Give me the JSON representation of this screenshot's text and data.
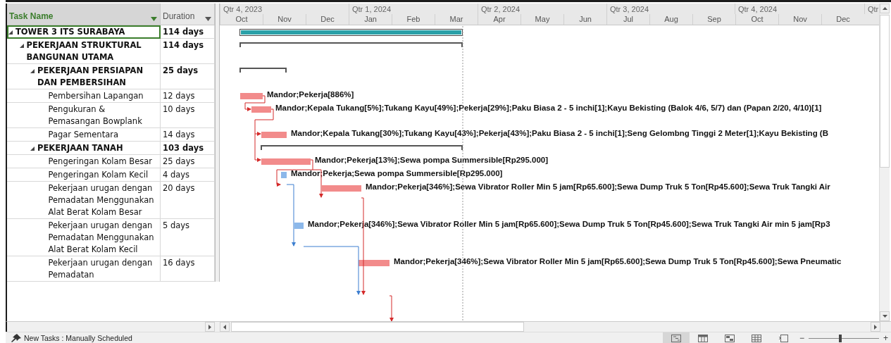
{
  "header": {
    "task_name": "Task Name",
    "duration": "Duration"
  },
  "timescale": {
    "quarters": [
      "Qtr 4, 2023",
      "Qtr 1, 2024",
      "Qtr 2, 2024",
      "Qtr 3, 2024",
      "Qtr 4, 2024",
      "Qtr"
    ],
    "months": [
      "Oct",
      "Nov",
      "Dec",
      "Jan",
      "Feb",
      "Mar",
      "Apr",
      "May",
      "Jun",
      "Jul",
      "Aug",
      "Sep",
      "Oct",
      "Nov",
      "Dec"
    ]
  },
  "tasks": [
    {
      "name": "TOWER 3 ITS SURABAYA",
      "duration": "114 days",
      "selected": true,
      "expanded": true,
      "kind": "project",
      "children": [
        {
          "name": "PEKERJAAN STRUKTURAL BANGUNAN UTAMA",
          "duration": "114 days",
          "selected": false,
          "expanded": true,
          "kind": "summary",
          "children": [
            {
              "name": "PEKERJAAN PERSIAPAN DAN PEMBERSIHAN",
              "duration": "25 days",
              "selected": false,
              "expanded": true,
              "kind": "summary",
              "children": [
                {
                  "name": "Pembersihan Lapangan",
                  "duration": "12 days",
                  "selected": false,
                  "kind": "task",
                  "critical": true,
                  "resources": "Mandor;Pekerja[886%]"
                },
                {
                  "name": "Pengukuran & Pemasangan Bowplank",
                  "duration": "10 days",
                  "selected": false,
                  "kind": "task",
                  "critical": true,
                  "resources": "Mandor;Kepala Tukang[5%];Tukang Kayu[49%];Pekerja[29%];Paku Biasa  2 - 5 inchi[1];Kayu Bekisting (Balok 4/6, 5/7) dan (Papan 2/20, 4/10)[1]"
                },
                {
                  "name": "Pagar Sementara",
                  "duration": "14 days",
                  "selected": false,
                  "kind": "task",
                  "critical": true,
                  "resources": "Mandor;Kepala Tukang[30%];Tukang Kayu[43%];Pekerja[43%];Paku Biasa  2 - 5 inchi[1];Seng Gelombng Tinggi 2 Meter[1];Kayu Bekisting (B"
                }
              ]
            },
            {
              "name": "PEKERJAAN TANAH",
              "duration": "103 days",
              "selected": false,
              "expanded": true,
              "kind": "summary",
              "children": [
                {
                  "name": "Pengeringan Kolam Besar",
                  "duration": "25 days",
                  "selected": false,
                  "kind": "task",
                  "critical": true,
                  "resources": "Mandor;Pekerja[13%];Sewa pompa Summersible[Rp295.000]"
                },
                {
                  "name": "Pengeringan Kolam Kecil",
                  "duration": "4 days",
                  "selected": false,
                  "kind": "task",
                  "critical": false,
                  "resources": "Mandor;Pekerja;Sewa pompa Summersible[Rp295.000]"
                },
                {
                  "name": "Pekerjaan urugan dengan Pemadatan Menggunakan Alat Berat Kolam Besar",
                  "duration": "20 days",
                  "selected": false,
                  "kind": "task",
                  "critical": true,
                  "resources": "Mandor;Pekerja[346%];Sewa Vibrator Roller Min 5 jam[Rp65.600];Sewa Dump Truk 5 Ton[Rp45.600];Sewa Truk Tangki Air"
                },
                {
                  "name": "Pekerjaan urugan dengan Pemadatan Menggunakan Alat Berat Kolam Kecil",
                  "duration": "5 days",
                  "selected": false,
                  "kind": "task",
                  "critical": false,
                  "resources": "Mandor;Pekerja[346%];Sewa Vibrator Roller Min 5 jam[Rp65.600];Sewa Dump Truk 5 Ton[Rp45.600];Sewa Truk Tangki Air min 5 jam[Rp3"
                },
                {
                  "name": "Pekerjaan urugan dengan Pemadatan",
                  "duration": "16 days",
                  "selected": false,
                  "kind": "task",
                  "critical": true,
                  "resources": "Mandor;Pekerja[346%];Sewa Vibrator Roller Min 5 jam[Rp65.600];Sewa Dump Truk 5 Ton[Rp45.600];Sewa Pneumatic"
                }
              ]
            }
          ]
        }
      ]
    }
  ],
  "status_bar": {
    "new_tasks": "New Tasks : Manually Scheduled",
    "views": [
      {
        "kind": "gantt",
        "selected": true
      },
      {
        "kind": "usage",
        "selected": false
      },
      {
        "kind": "planner",
        "selected": false
      },
      {
        "kind": "sheet",
        "selected": false
      },
      {
        "kind": "timeline",
        "selected": false
      }
    ],
    "zoom": {
      "minus": "−",
      "plus": "+",
      "level": 0.45
    }
  }
}
